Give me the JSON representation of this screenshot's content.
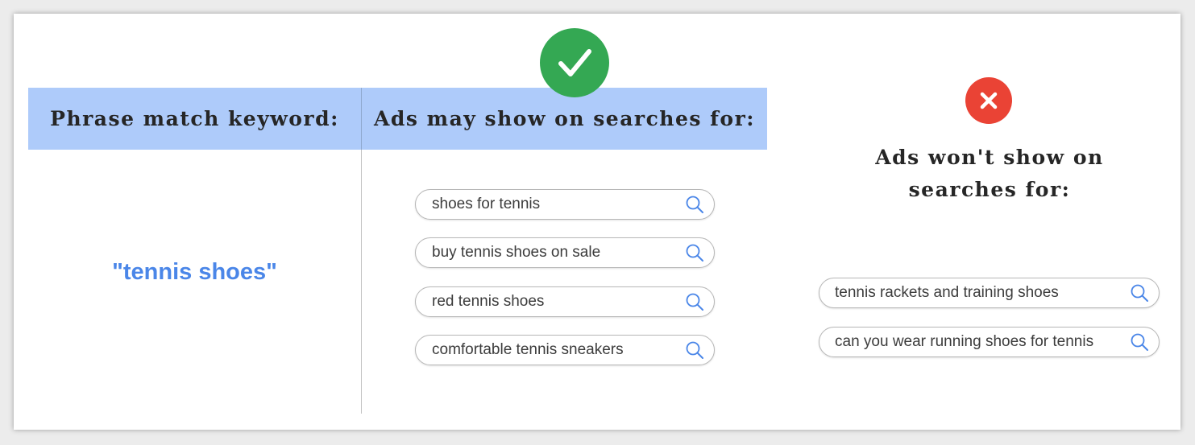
{
  "headers": {
    "keyword": "Phrase match keyword:",
    "may_show": "Ads may show on searches for:",
    "wont_show_line1": "Ads won't show on",
    "wont_show_line2": "searches for:"
  },
  "keyword": "\"tennis shoes\"",
  "matching_searches": [
    "shoes for tennis",
    "buy tennis shoes on sale",
    "red tennis shoes",
    "comfortable tennis sneakers"
  ],
  "non_matching_searches": [
    "tennis rackets and training shoes",
    "can you wear running shoes for tennis"
  ],
  "icons": {
    "match": "check-icon",
    "no_match": "x-icon",
    "search": "search-icon"
  },
  "colors": {
    "header_bg": "#aecbfa",
    "keyword": "#4a86e8",
    "check": "#34a853",
    "cross": "#ea4335",
    "search_icon": "#4a86e8"
  }
}
